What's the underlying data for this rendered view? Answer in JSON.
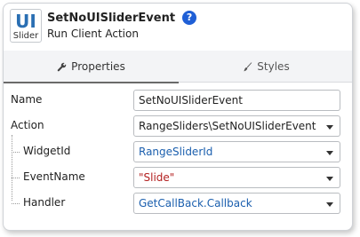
{
  "header": {
    "logo_text": "UI",
    "logo_caption": "Slider",
    "title": "SetNoUISliderEvent",
    "subtitle": "Run Client Action",
    "help_glyph": "?"
  },
  "tabs": [
    {
      "label": "Properties",
      "icon": "wrench-icon",
      "active": true
    },
    {
      "label": "Styles",
      "icon": "brush-icon",
      "active": false
    }
  ],
  "properties": {
    "name": {
      "label": "Name",
      "value": "SetNoUISliderEvent"
    },
    "action": {
      "label": "Action",
      "value": "RangeSliders\\SetNoUISliderEvent"
    },
    "widget_id": {
      "label": "WidgetId",
      "value": "RangeSliderId"
    },
    "event_name": {
      "label": "EventName",
      "value": "\"Slide\""
    },
    "handler": {
      "label": "Handler",
      "value": "GetCallBack.Callback"
    }
  },
  "colors": {
    "accent_blue": "#1b5fae",
    "string_red": "#b32020",
    "help_badge": "#1f5fd6"
  }
}
